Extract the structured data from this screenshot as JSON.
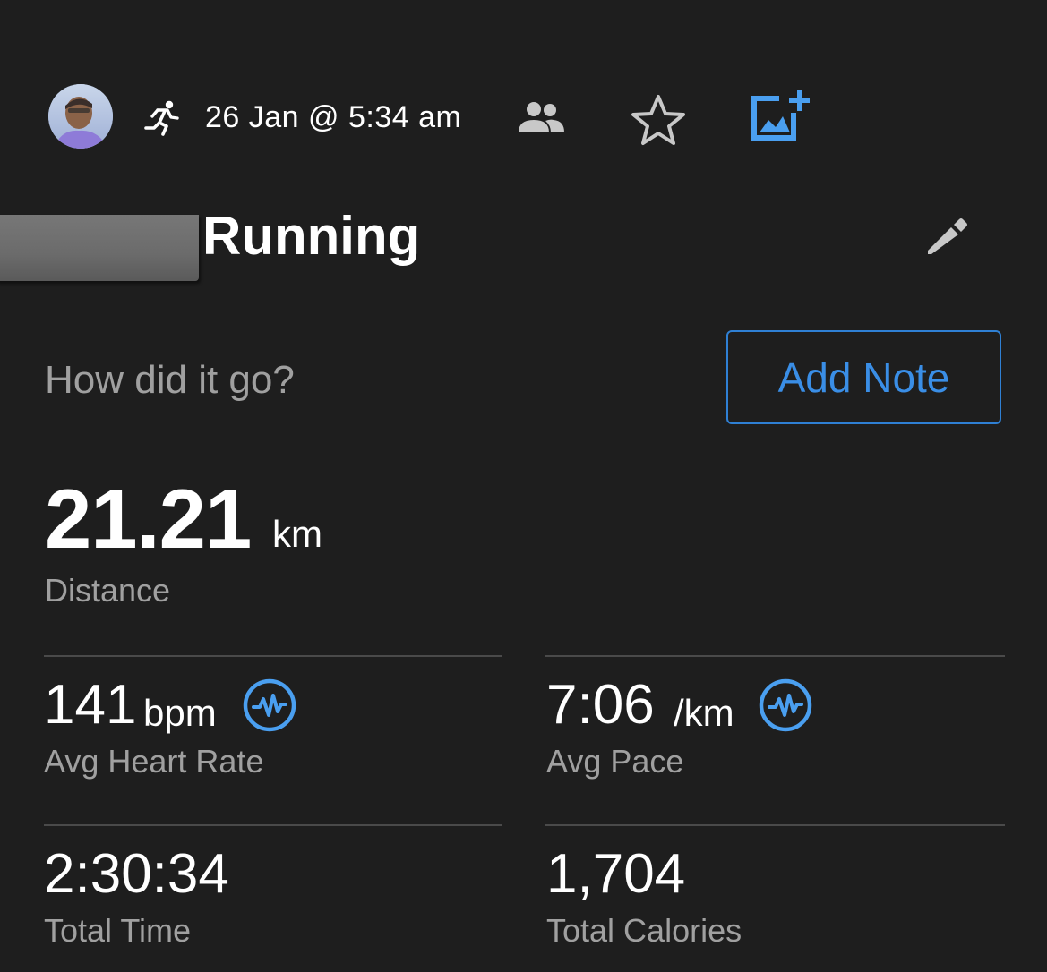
{
  "header": {
    "date_time": "26 Jan @ 5:34 am",
    "icons": [
      "avatar",
      "running-icon",
      "people-icon",
      "star-icon",
      "add-photo-icon"
    ]
  },
  "activity": {
    "title": "Running",
    "edit_icon": "pencil-icon"
  },
  "note": {
    "prompt": "How did it go?",
    "button_label": "Add Note"
  },
  "distance": {
    "value": "21.21",
    "unit": "km",
    "label": "Distance"
  },
  "stats": {
    "heart_rate": {
      "value": "141",
      "unit": "bpm",
      "label": "Avg Heart Rate",
      "icon": "heart-rate-wave-icon"
    },
    "pace": {
      "value": "7:06",
      "unit": "/km",
      "label": "Avg Pace",
      "icon": "heart-rate-wave-icon"
    },
    "total_time": {
      "value": "2:30:34",
      "label": "Total Time"
    },
    "total_calories": {
      "value": "1,704",
      "label": "Total Calories"
    }
  },
  "colors": {
    "background": "#1e1e1e",
    "accent_blue": "#2f80d4",
    "icon_blue": "#4a9ff0",
    "secondary_text": "#a0a0a0",
    "divider": "#4a4a4a"
  }
}
